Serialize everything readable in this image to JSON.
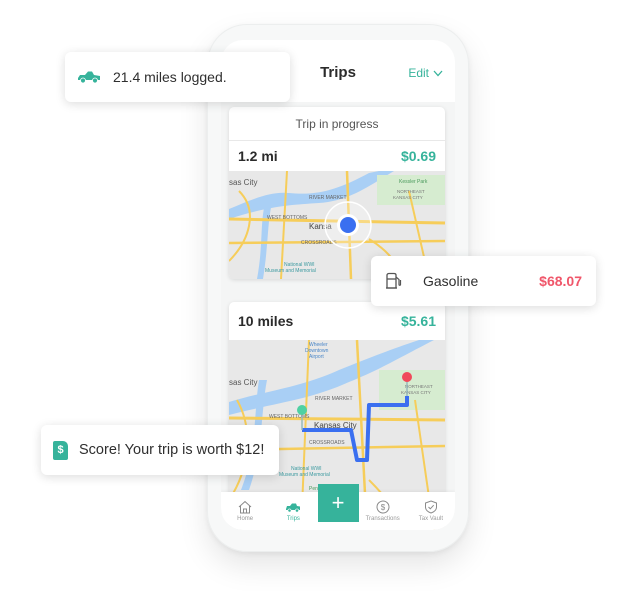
{
  "app": {
    "title": "Trips",
    "edit_label": "Edit"
  },
  "trip_in_progress": {
    "banner": "Trip in progress",
    "distance": "1.2 mi",
    "amount": "$0.69",
    "map_labels": [
      "Kansas City",
      "RIVER MARKET",
      "WEST BOTTOMS",
      "Kansas",
      "CROSSROADS",
      "Kessler Park",
      "NORTHEAST KANSAS CITY",
      "National WWI Museum and Memorial"
    ]
  },
  "trip_completed": {
    "distance": "10 miles",
    "amount": "$5.61",
    "map_labels": [
      "Wheeler Downtown Airport",
      "Kansas City",
      "RIVER MARKET",
      "WEST BOTTOMS",
      "Kansas City",
      "CROSSROADS",
      "NORTHEAST KANSAS CITY",
      "National WWI Museum and Memorial",
      "Penn Valley Park"
    ]
  },
  "toasts": {
    "miles": {
      "icon": "car-icon",
      "text": "21.4 miles logged."
    },
    "gas": {
      "icon": "gas-pump-icon",
      "label": "Gasoline",
      "amount": "$68.07"
    },
    "score": {
      "icon": "dollar-document-icon",
      "badge": "$",
      "text": "Score! Your trip is worth $12!"
    }
  },
  "tabbar": {
    "items": [
      {
        "label": "Home",
        "icon": "home-icon"
      },
      {
        "label": "Trips",
        "icon": "car-icon",
        "active": true
      },
      {
        "label": "+",
        "icon": "plus-icon"
      },
      {
        "label": "Transactions",
        "icon": "dollar-circle-icon"
      },
      {
        "label": "Tax Vault",
        "icon": "shield-check-icon"
      }
    ]
  },
  "colors": {
    "accent": "#36b39b",
    "expense": "#f0566a",
    "location_dot": "#3a6ff0",
    "route": "#3a6ff0",
    "start_pin": "#4fd1a3",
    "end_pin": "#f04a5a"
  }
}
